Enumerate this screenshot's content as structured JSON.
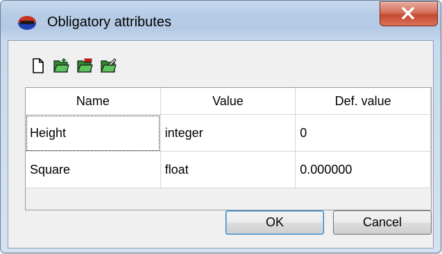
{
  "window": {
    "title": "Obligatory attributes"
  },
  "toolbar": {
    "items": [
      {
        "icon": "new-document-icon"
      },
      {
        "icon": "folder-add-icon"
      },
      {
        "icon": "folder-remove-icon"
      },
      {
        "icon": "folder-edit-icon"
      }
    ]
  },
  "table": {
    "columns": [
      "Name",
      "Value",
      "Def. value"
    ],
    "rows": [
      [
        "Height",
        "integer",
        "0"
      ],
      [
        "Square",
        "float",
        "0.000000"
      ]
    ]
  },
  "buttons": {
    "ok": "OK",
    "cancel": "Cancel"
  },
  "colors": {
    "title_bar": "#b7cce6",
    "close_button": "#c54a30",
    "folder_green": "#3aa53a",
    "default_button_border": "#3c7fb1"
  }
}
